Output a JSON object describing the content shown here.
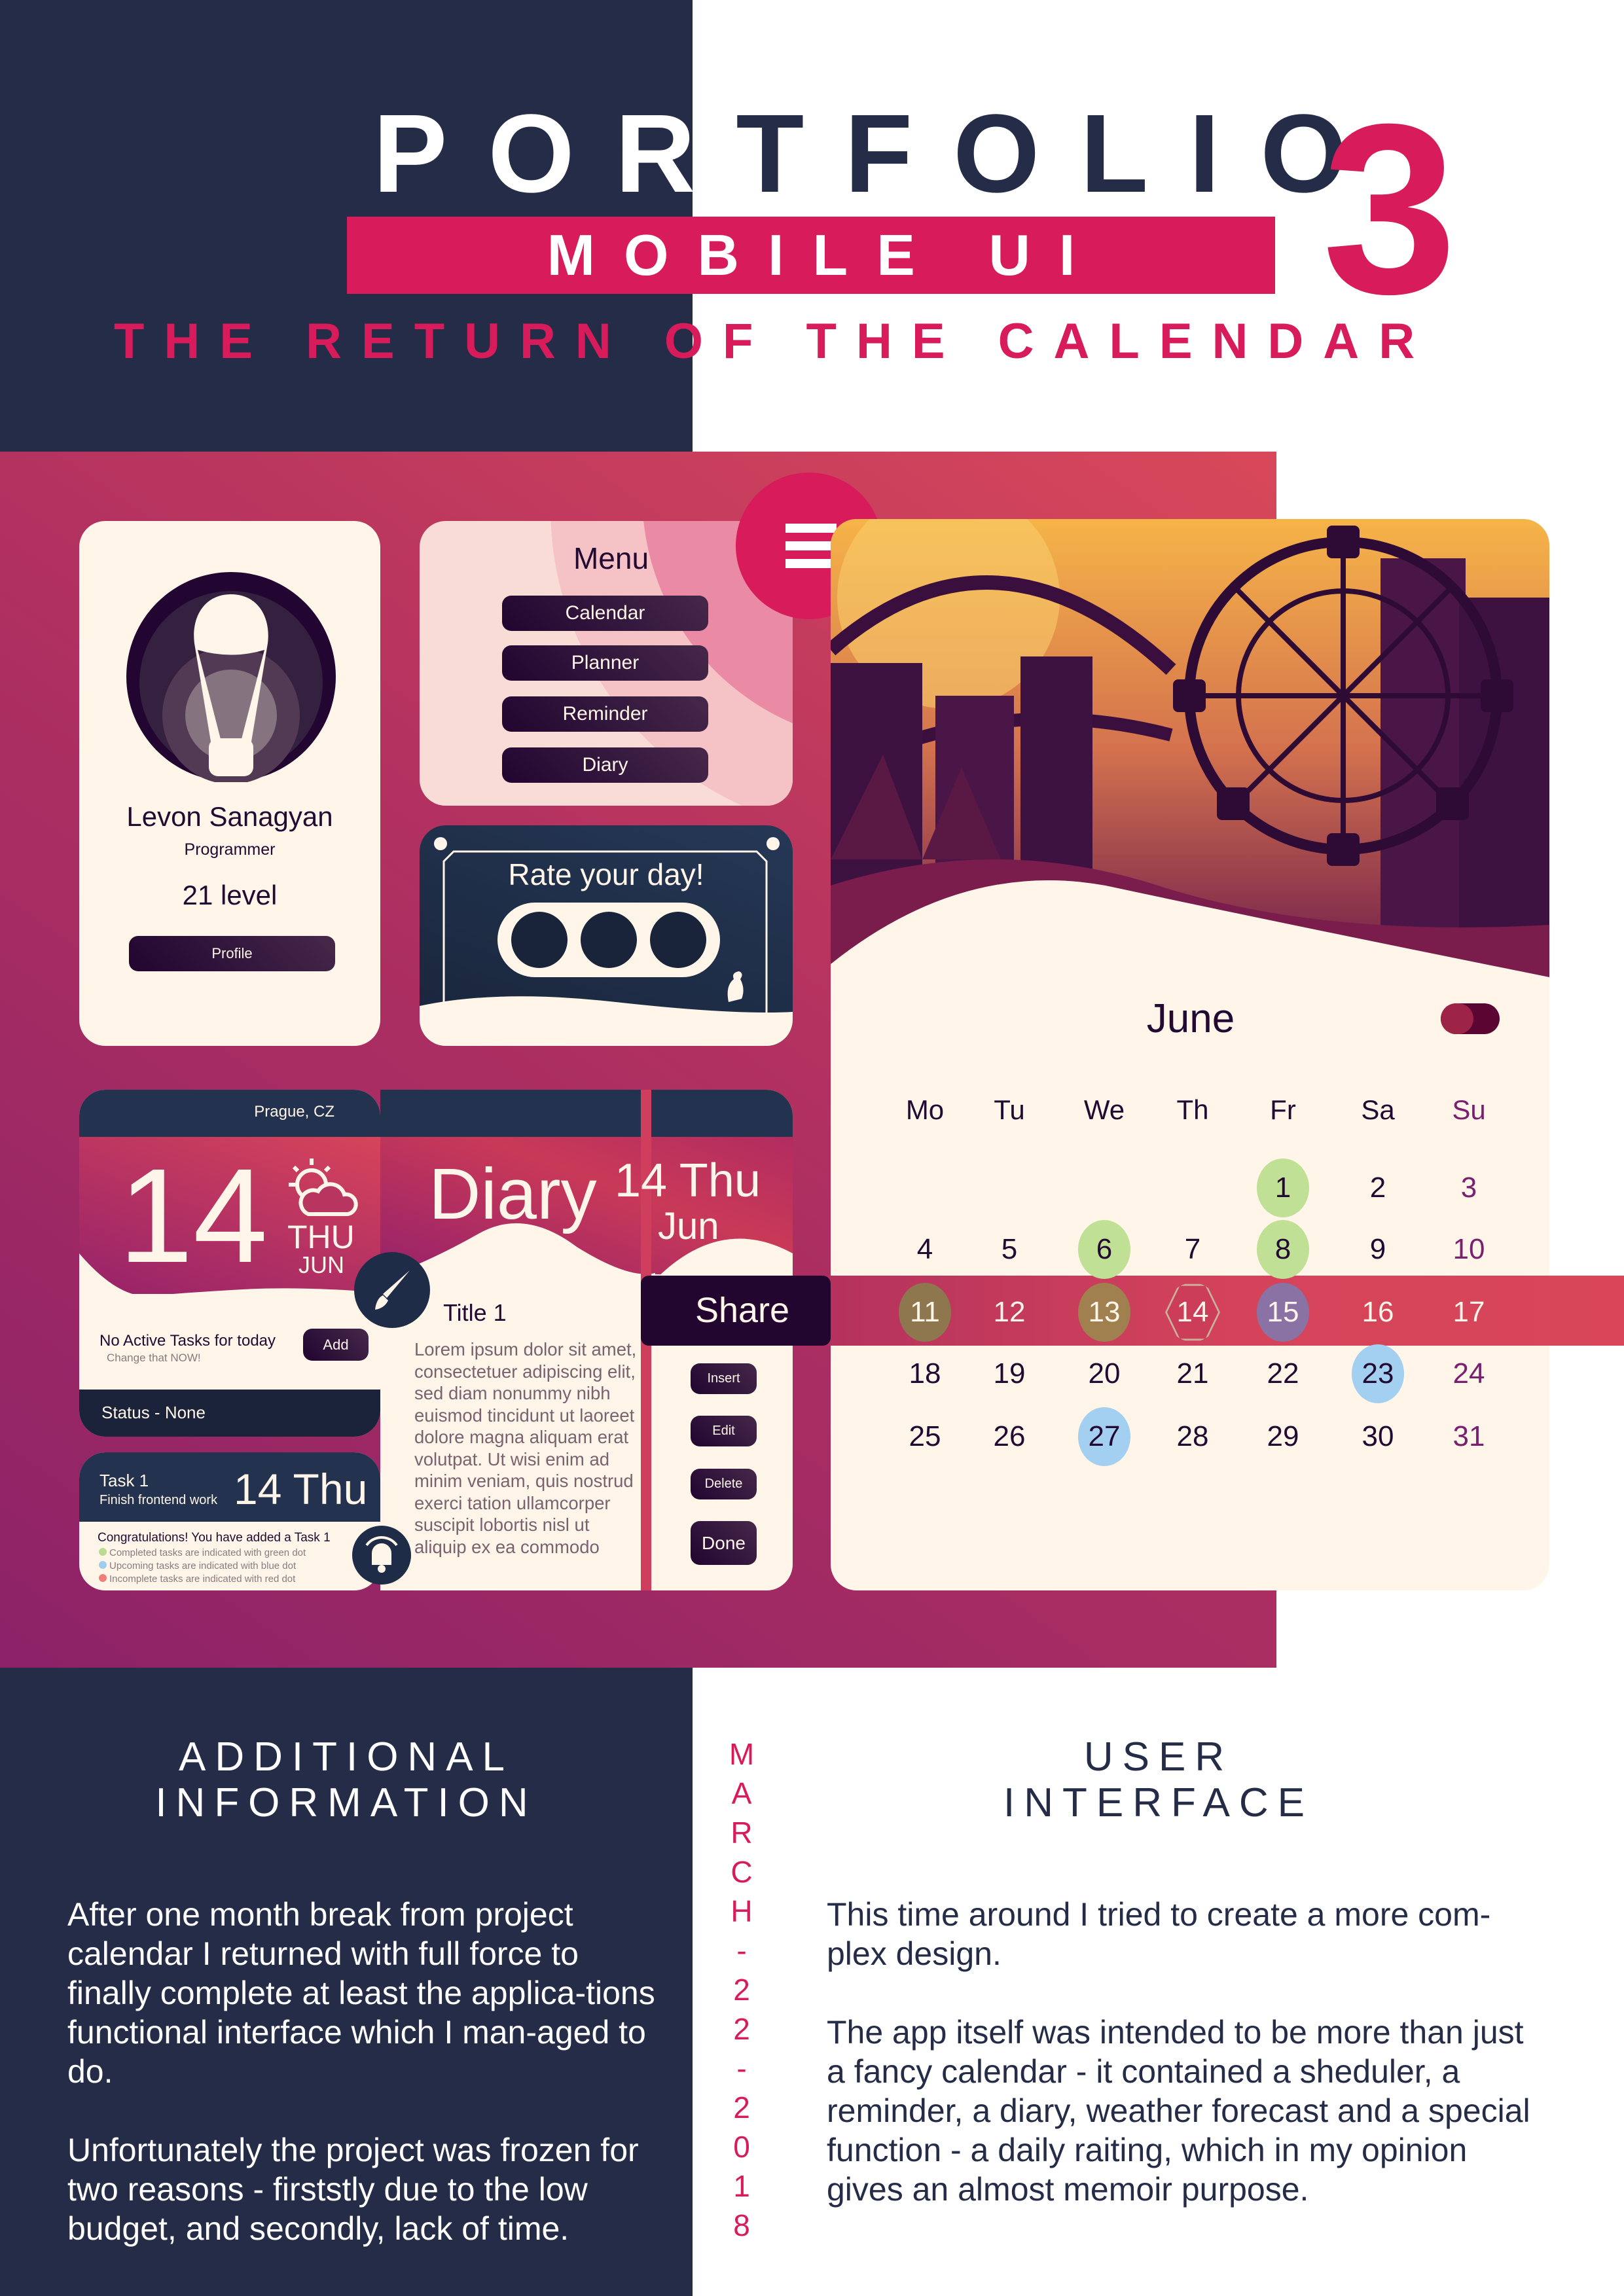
{
  "header": {
    "title_part1": "POR",
    "title_part2": "TFOLIO",
    "number": "3",
    "subtitle_bar": "MOBILE UI",
    "tagline": "THE RETURN OF THE CALENDAR"
  },
  "profile": {
    "name": "Levon Sanagyan",
    "role": "Programmer",
    "level": "21 level",
    "button": "Profile"
  },
  "menu": {
    "title": "Menu",
    "items": [
      "Calendar",
      "Planner",
      "Reminder",
      "Diary"
    ],
    "icon": "hamburger-icon"
  },
  "rate": {
    "title": "Rate your day!"
  },
  "weather": {
    "location": "Prague, CZ",
    "day": "14",
    "weekday": "THU",
    "month": "JUN",
    "icon": "partly-cloudy-icon",
    "tasks_text": "No Active Tasks for today",
    "tasks_hint": "Change that NOW!",
    "add_button": "Add",
    "status": "Status - None"
  },
  "task": {
    "title": "Task 1",
    "subtitle": "Finish frontend work",
    "date": "14 Thu",
    "congrats": "Congratulations! You have added a Task 1",
    "legend": [
      {
        "text": "Completed tasks are indicated with green dot",
        "color": "#b9dd8f"
      },
      {
        "text": "Upcoming tasks are indicated with blue dot",
        "color": "#9fcdee"
      },
      {
        "text": "Incomplete tasks are indicated with red dot",
        "color": "#f07f7a"
      }
    ]
  },
  "diary": {
    "title": "Diary",
    "date": "14 Thu",
    "month": "Jun",
    "entry_title": "Title 1",
    "body": "Lorem ipsum dolor sit amet, consectetuer adipiscing elit, sed diam nonummy nibh euismod tincidunt ut laoreet dolore magna aliquam erat volutpat. Ut wisi enim ad minim veniam, quis nostrud exerci tation ullamcorper suscipit lobortis nisl ut aliquip ex ea commodo",
    "share": "Share",
    "buttons": [
      "Insert",
      "Edit",
      "Delete",
      "Done"
    ]
  },
  "calendar": {
    "month": "June",
    "weekdays": [
      "Mo",
      "Tu",
      "We",
      "Th",
      "Fr",
      "Sa",
      "Su"
    ],
    "weeks": [
      [
        null,
        null,
        null,
        null,
        1,
        2,
        3
      ],
      [
        4,
        5,
        6,
        7,
        8,
        9,
        10
      ],
      [
        11,
        12,
        13,
        14,
        15,
        16,
        17
      ],
      [
        18,
        19,
        20,
        21,
        22,
        23,
        24
      ],
      [
        25,
        26,
        27,
        28,
        29,
        30,
        31
      ]
    ],
    "today": 14,
    "markers": {
      "1": "#bfe095",
      "6": "#bfe095",
      "8": "#bfe095",
      "11": "#8e774f",
      "13": "#a0804f",
      "15": "#8a72a5",
      "23": "#a3cff0",
      "27": "#a3cff0"
    },
    "colors": {
      "sunday": "#7a2070",
      "highlight_band": "#d4435a"
    }
  },
  "additional": {
    "title_line1": "ADDITIONAL",
    "title_line2": "INFORMATION",
    "paragraphs": [
      "After one month break from project calendar I returned with full force to finally complete at least the applica-tions functional interface which I man-aged to do.",
      "Unfortunately the project was frozen for two reasons - firststly due to the low budget, and secondly, lack of time."
    ]
  },
  "date_vertical": [
    "M",
    "A",
    "R",
    "C",
    "H",
    "-",
    "2",
    "2",
    "-",
    "2",
    "0",
    "1",
    "8"
  ],
  "user_interface": {
    "title_line1": "USER",
    "title_line2": "INTERFACE",
    "paragraphs": [
      "This time around I tried to create a more com-plex design.",
      "The app itself was intended to be more than just a fancy calendar - it contained a sheduler, a reminder, a diary, weather forecast and a special function - a daily raiting, which in my opinion gives an almost memoir purpose."
    ]
  }
}
